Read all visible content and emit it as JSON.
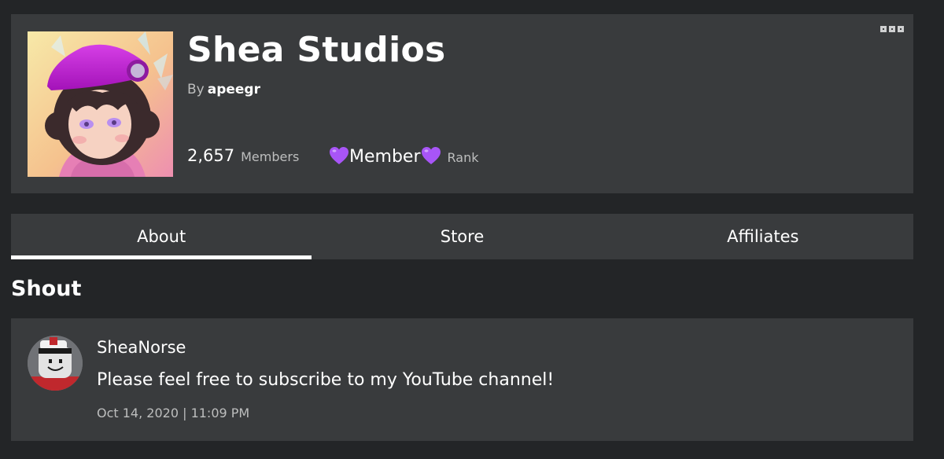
{
  "group": {
    "name": "Shea Studios",
    "owner_prefix": "By",
    "owner_name": "apeegr",
    "members_count": "2,657",
    "members_label": "Members",
    "rank_value": "Member",
    "rank_label": "Rank",
    "rank_heart_color": "#a855f7",
    "emblem_icon": "group-emblem-avatar"
  },
  "header_menu": {
    "icon": "more-options-icon"
  },
  "tabs": [
    {
      "label": "About",
      "active": true
    },
    {
      "label": "Store",
      "active": false
    },
    {
      "label": "Affiliates",
      "active": false
    }
  ],
  "shout": {
    "section_title": "Shout",
    "author": "SheaNorse",
    "message": "Please feel free to subscribe to my YouTube channel!",
    "timestamp": "Oct 14, 2020 | 11:09 PM",
    "avatar_icon": "user-avatar"
  },
  "colors": {
    "background": "#232527",
    "card": "#393b3d",
    "text_primary": "#ffffff",
    "text_secondary": "#bdbebe",
    "accent_purple": "#c21bd6"
  }
}
